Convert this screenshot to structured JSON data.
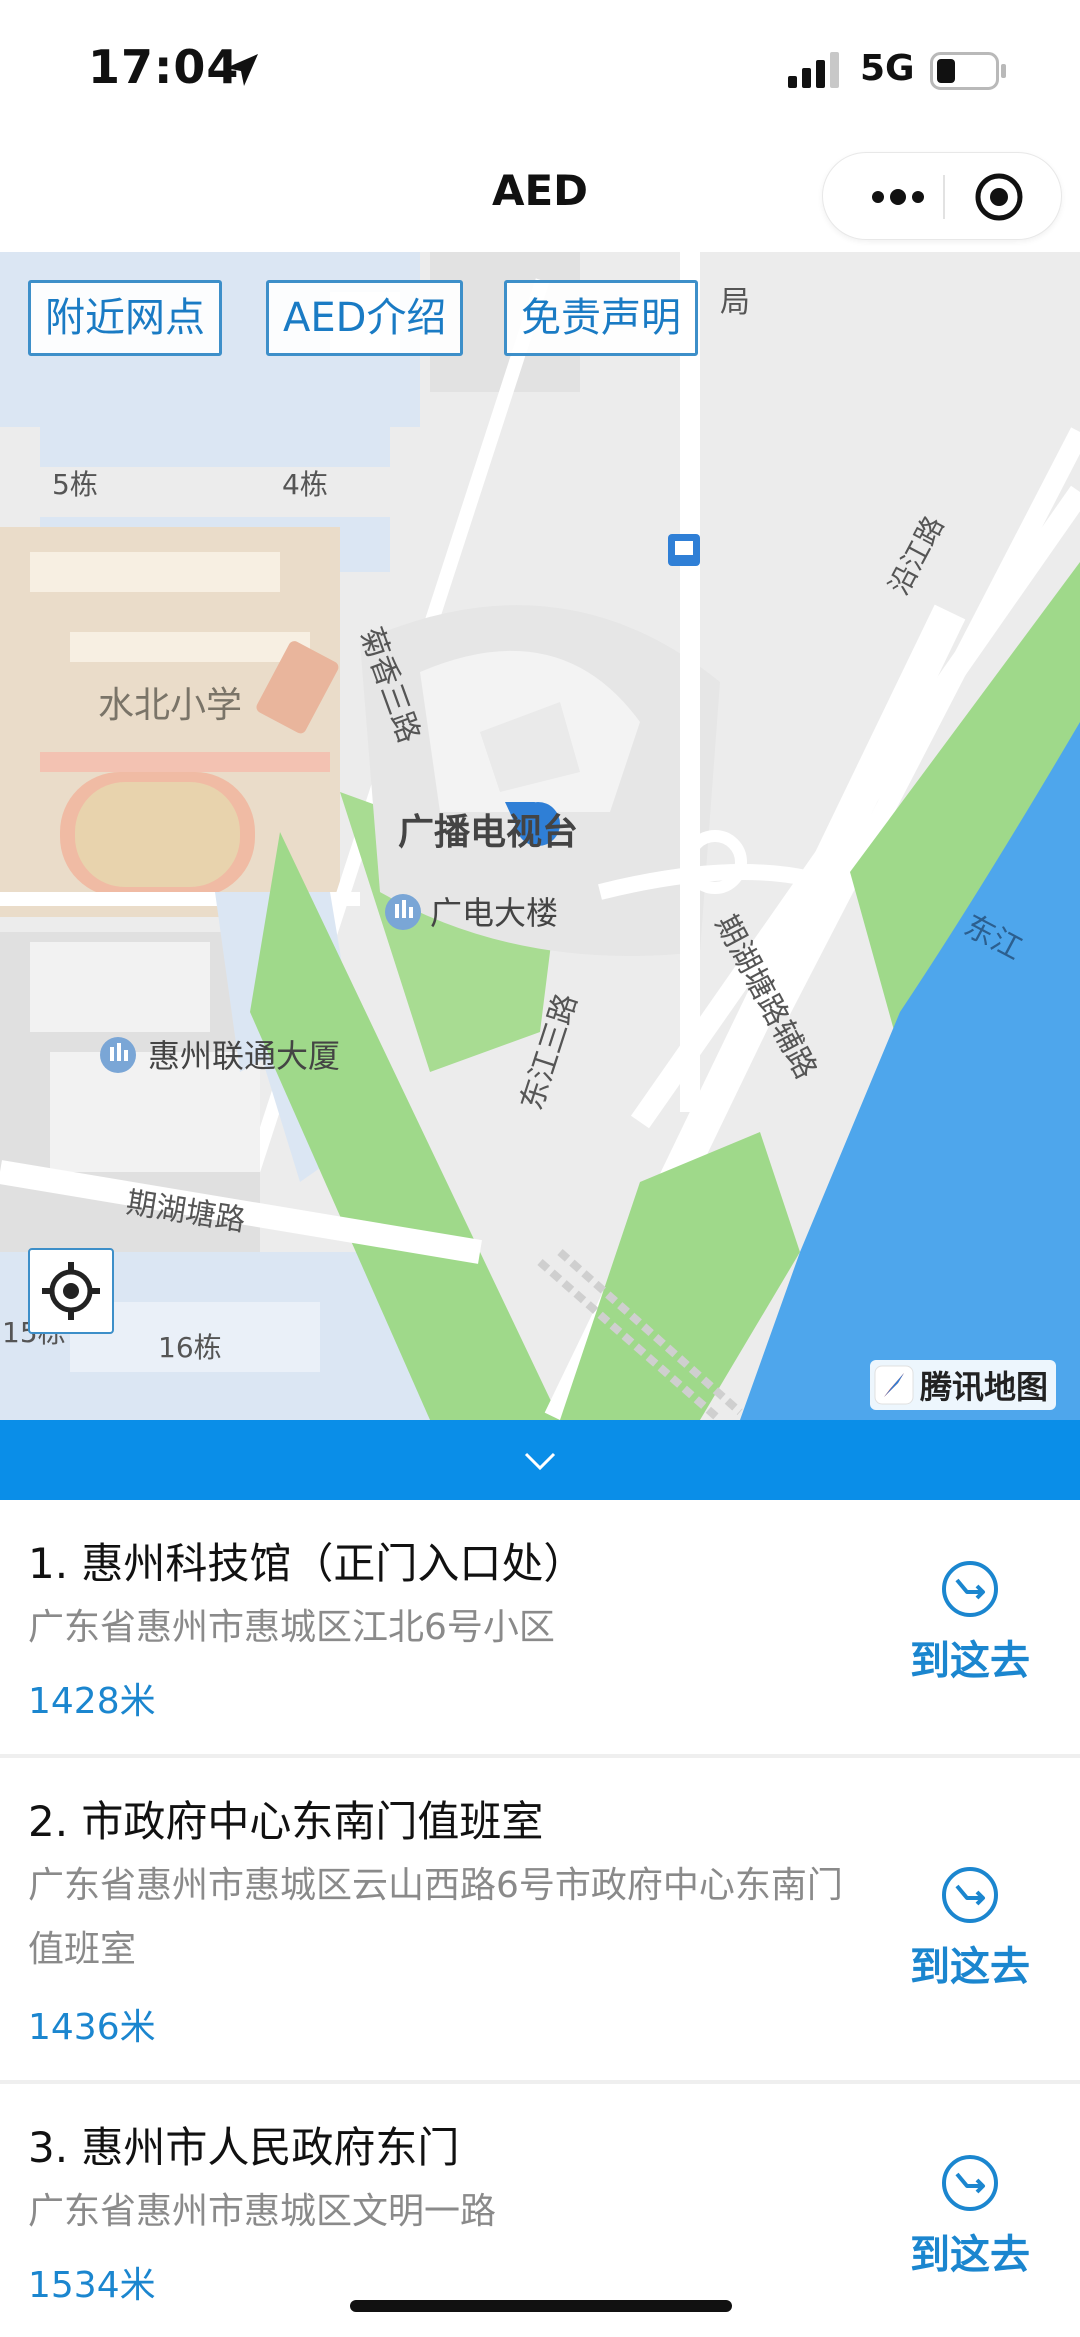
{
  "status_bar": {
    "time": "17:04",
    "network": "5G"
  },
  "nav": {
    "title": "AED"
  },
  "map": {
    "buttons": {
      "nearby": "附近网点",
      "intro": "AED介绍",
      "disclaimer": "免责声明"
    },
    "labels": {
      "ju": "局",
      "bldg5": "5栋",
      "bldg4": "4栋",
      "school": "水北小学",
      "juxiang_road": "菊香三路",
      "tv_station": "广播电视台",
      "gd_building": "广电大楼",
      "unicom": "惠州联通大厦",
      "qihutang_road": "期湖塘路",
      "bldg15": "15栋",
      "bldg16": "16栋",
      "dongjiang_road": "东江三路",
      "qihutang_aux": "期湖塘路辅路",
      "yanjiang_road": "沿江路",
      "river": "东江"
    },
    "attribution": "腾讯地图"
  },
  "results": [
    {
      "title": "1. 惠州科技馆（正门入口处）",
      "address": "广东省惠州市惠城区江北6号小区",
      "distance": "1428米",
      "action": "到这去"
    },
    {
      "title": "2. 市政府中心东南门值班室",
      "address": "广东省惠州市惠城区云山西路6号市政府中心东南门值班室",
      "distance": "1436米",
      "action": "到这去"
    },
    {
      "title": "3. 惠州市人民政府东门",
      "address": "广东省惠州市惠城区文明一路",
      "distance": "1534米",
      "action": "到这去"
    }
  ],
  "colors": {
    "accent": "#0a8ee8",
    "link": "#1b86cf",
    "river": "#4ea6ec",
    "park": "#9fd98a"
  },
  "icons": [
    "location-arrow-icon",
    "signal-icon",
    "battery-icon",
    "more-icon",
    "close-target-icon",
    "locate-icon",
    "tencent-map-logo-icon",
    "chevron-down-icon",
    "navigate-icon"
  ]
}
